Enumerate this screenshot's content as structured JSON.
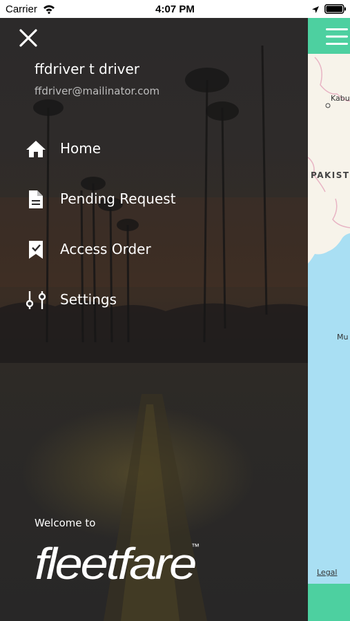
{
  "status_bar": {
    "carrier": "Carrier",
    "time": "4:07 PM"
  },
  "drawer": {
    "user": {
      "name": "ffdriver t driver",
      "email": "ffdriver@mailinator.com"
    },
    "menu": [
      {
        "label": "Home",
        "icon": "home-icon"
      },
      {
        "label": "Pending Request",
        "icon": "document-icon"
      },
      {
        "label": "Access Order",
        "icon": "bookmark-icon"
      },
      {
        "label": "Settings",
        "icon": "sliders-icon"
      }
    ],
    "welcome": "Welcome to",
    "brand": {
      "name": "fleetfare",
      "trademark": "™"
    },
    "background_color": "#2b2929"
  },
  "map": {
    "labels": {
      "city1": "Kabu",
      "country": "PAKIST",
      "city2": "Mu"
    },
    "legal": "Legal",
    "accent_color": "#4dd0a0",
    "water_color": "#a9dff3"
  }
}
